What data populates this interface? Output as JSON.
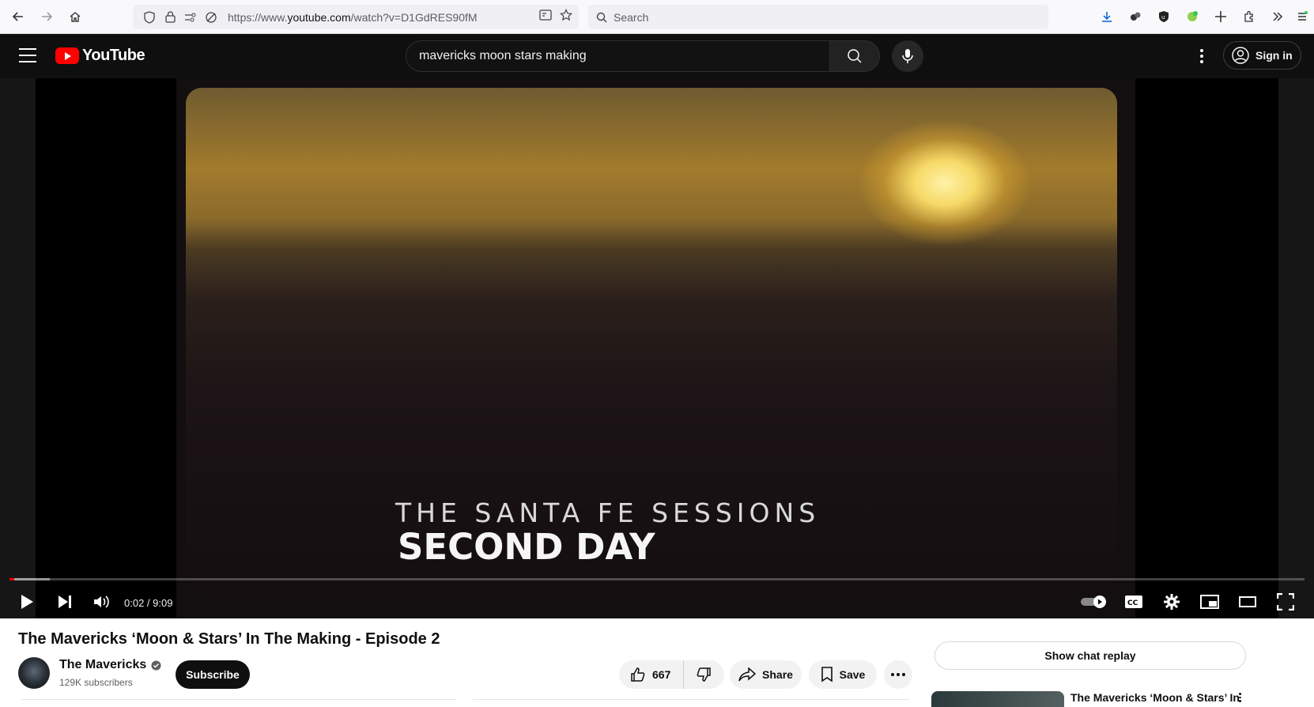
{
  "browser": {
    "url_prefix": "https://www.",
    "url_domain": "youtube.com",
    "url_path": "/watch?v=D1GdRES90fM",
    "search_placeholder": "Search"
  },
  "header": {
    "logo_text": "YouTube",
    "search_value": "mavericks moon stars making",
    "signin_label": "Sign in"
  },
  "video": {
    "overlay_line1": "THE SANTA FE SESSIONS",
    "overlay_line2": "SECOND DAY",
    "time_display": "0:02 / 9:09",
    "played_fraction": 0.0037,
    "loaded_fraction": 0.031,
    "accent_color": "#ff0000"
  },
  "details": {
    "title": "The Mavericks ‘Moon & Stars’ In The Making - Episode 2",
    "channel_name": "The Mavericks",
    "subscribers": "129K subscribers",
    "subscribe_label": "Subscribe",
    "like_count": "667",
    "share_label": "Share",
    "save_label": "Save"
  },
  "sidebar": {
    "chat_replay_label": "Show chat replay",
    "rec_title": "The Mavericks ‘Moon & Stars’ In"
  },
  "icons": [
    "back-icon",
    "forward-icon",
    "home-icon",
    "shield-icon",
    "lock-icon",
    "permissions-icon",
    "tracking-icon",
    "reader-icon",
    "star-icon",
    "search-icon",
    "download-icon",
    "extension-icon",
    "ublock-icon",
    "extension-green-icon",
    "pin-icon",
    "puzzle-icon",
    "overflow-icon",
    "menu-icon",
    "mic-icon",
    "play-icon",
    "next-icon",
    "volume-icon",
    "autoplay-toggle-icon",
    "cc-icon",
    "settings-icon",
    "miniplayer-icon",
    "theater-icon",
    "fullscreen-icon",
    "like-icon",
    "dislike-icon",
    "share-icon",
    "save-icon",
    "more-icon",
    "verified-icon",
    "account-icon"
  ]
}
